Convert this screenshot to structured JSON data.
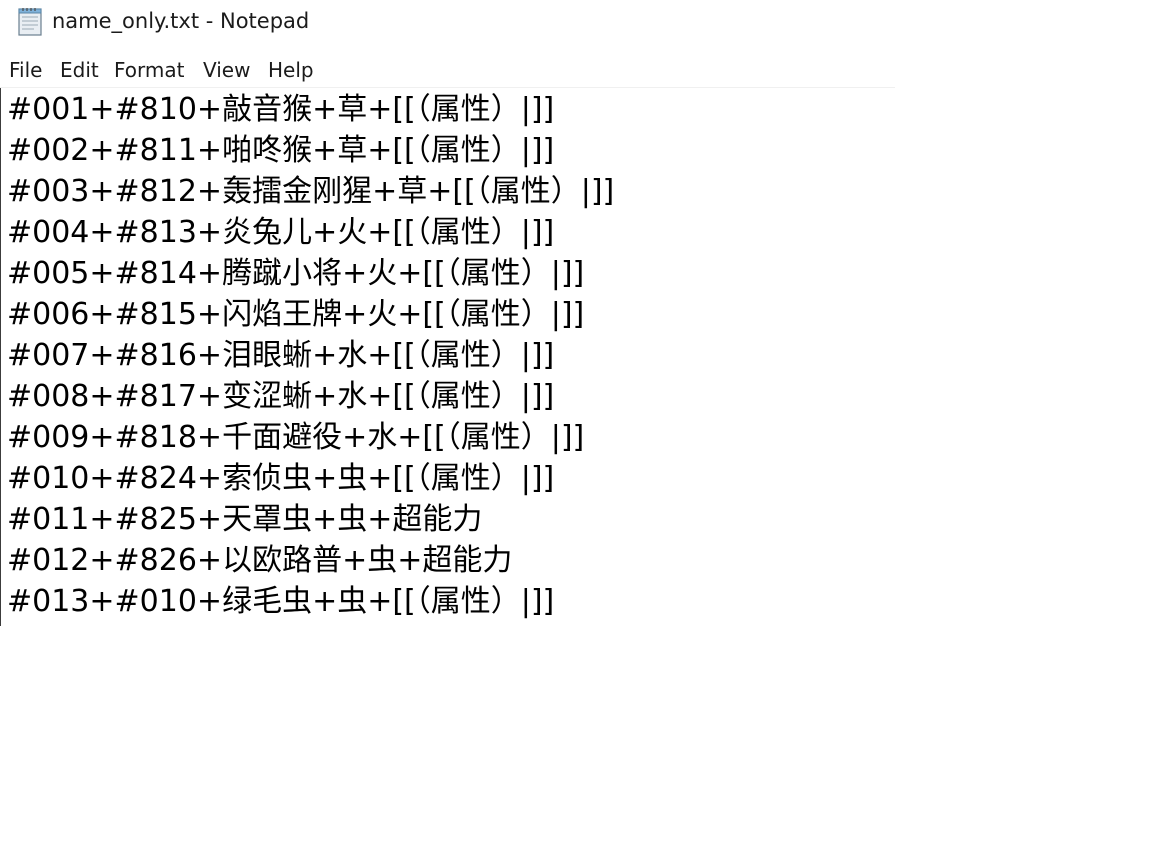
{
  "window": {
    "title": "name_only.txt - Notepad",
    "icon": "notepad-icon"
  },
  "menu": {
    "file": "File",
    "edit": "Edit",
    "format": "Format",
    "view": "View",
    "help": "Help"
  },
  "document": {
    "lines": [
      "#001+#810+敲音猴+草+[[（属性）|]]",
      "#002+#811+啪咚猴+草+[[（属性）|]]",
      "#003+#812+轰擂金刚猩+草+[[（属性）|]]",
      "#004+#813+炎兔儿+火+[[（属性）|]]",
      "#005+#814+腾蹴小将+火+[[（属性）|]]",
      "#006+#815+闪焰王牌+火+[[（属性）|]]",
      "#007+#816+泪眼蜥+水+[[（属性）|]]",
      "#008+#817+变涩蜥+水+[[（属性）|]]",
      "#009+#818+千面避役+水+[[（属性）|]]",
      "#010+#824+索侦虫+虫+[[（属性）|]]",
      "#011+#825+天罩虫+虫+超能力",
      "#012+#826+以欧路普+虫+超能力",
      "#013+#010+绿毛虫+虫+[[（属性）|]]"
    ]
  }
}
